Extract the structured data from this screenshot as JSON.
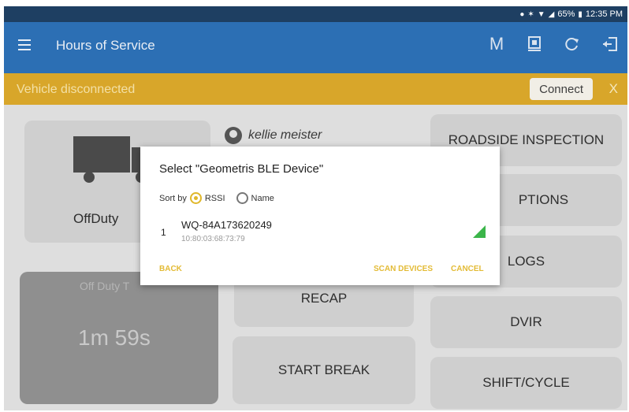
{
  "status_bar": {
    "battery": "65%",
    "time": "12:35 PM"
  },
  "app_bar": {
    "title": "Hours of Service",
    "actions": [
      "M",
      "device-icon",
      "refresh-icon",
      "logout-icon"
    ]
  },
  "banner": {
    "text": "Vehicle disconnected",
    "connect_label": "Connect",
    "close_label": "X"
  },
  "duty_card": {
    "status": "OffDuty"
  },
  "user": {
    "name": "kellie meister"
  },
  "offduty_card": {
    "label": "Off Duty T",
    "time": "1m 59s"
  },
  "buttons": {
    "recap": "RECAP",
    "start_break": "START BREAK",
    "roadside": "ROADSIDE INSPECTION",
    "options": "PTIONS",
    "logs": "LOGS",
    "dvir": "DVIR",
    "shift_cycle": "SHIFT/CYCLE"
  },
  "dialog": {
    "title": "Select \"Geometris BLE Device\"",
    "sort_by_label": "Sort by",
    "sort_options": [
      {
        "label": "RSSI",
        "selected": true
      },
      {
        "label": "Name",
        "selected": false
      }
    ],
    "devices": [
      {
        "index": "1",
        "name": "WQ-84A173620249",
        "mac": "10:80:03:68:73:79"
      }
    ],
    "actions": {
      "back": "BACK",
      "scan": "SCAN DEVICES",
      "cancel": "CANCEL"
    }
  },
  "colors": {
    "app_bar": "#2c6fb4",
    "status_bar": "#1e3f62",
    "banner": "#d8a62a",
    "accent": "#e0b72a",
    "signal": "#3bb54a"
  }
}
